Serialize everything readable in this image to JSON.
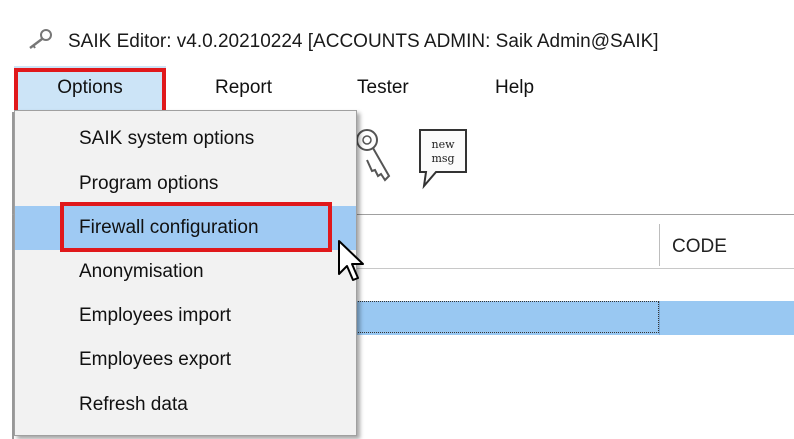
{
  "window": {
    "title": "SAIK Editor: v4.0.20210224 [ACCOUNTS ADMIN: Saik Admin@SAIK]",
    "icon": "key-icon"
  },
  "menubar": {
    "items": [
      {
        "label": "Options",
        "active": true
      },
      {
        "label": "Report"
      },
      {
        "label": "Tester"
      },
      {
        "label": "Help"
      }
    ]
  },
  "dropdown": {
    "items": [
      {
        "label": "SAIK system options"
      },
      {
        "label": "Program options"
      },
      {
        "label": "Firewall configuration",
        "highlighted": true
      },
      {
        "label": "Anonymisation"
      },
      {
        "label": "Employees import"
      },
      {
        "label": "Employees export"
      },
      {
        "label": "Refresh data"
      }
    ]
  },
  "toolbar": {
    "icons": [
      "key-icon",
      "new-message-icon"
    ],
    "new_msg_line1": "new",
    "new_msg_line2": "msg"
  },
  "grid": {
    "columns": [
      "CODE"
    ]
  },
  "colors": {
    "highlight_box": "#e0181b",
    "menu_hover": "#cce4f7",
    "item_highlight": "#9fcaf3",
    "selected_row": "#99c8f2"
  }
}
